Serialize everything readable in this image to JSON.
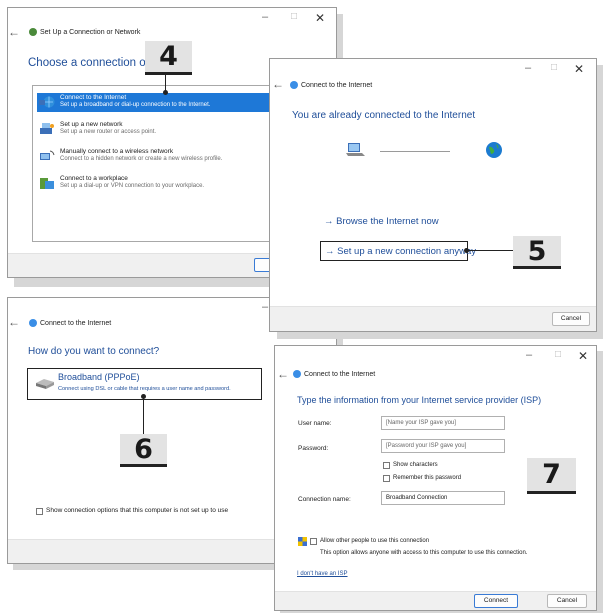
{
  "window_controls": {
    "minimize": "–",
    "maximize": "□",
    "close": "✕"
  },
  "back_arrow": "←",
  "w1": {
    "title": "Set Up a Connection or Network",
    "heading": "Choose a connection option",
    "options": [
      {
        "title": "Connect to the Internet",
        "desc": "Set up a broadband or dial-up connection to the Internet.",
        "icon": "internet-globe-icon"
      },
      {
        "title": "Set up a new network",
        "desc": "Set up a new router or access point.",
        "icon": "router-icon"
      },
      {
        "title": "Manually connect to a wireless network",
        "desc": "Connect to a hidden network or create a new wireless profile.",
        "icon": "wireless-network-icon"
      },
      {
        "title": "Connect to a workplace",
        "desc": "Set up a dial-up or VPN connection to your workplace.",
        "icon": "workplace-icon"
      }
    ],
    "next_label": "Next"
  },
  "w2": {
    "title": "Connect to the Internet",
    "heading": "You are already connected to the Internet",
    "browse_link": "→ Browse the Internet now",
    "setup_link": "→ Set up a new connection anyway",
    "cancel_label": "Cancel"
  },
  "w3": {
    "title": "Connect to the Internet",
    "heading": "How do you want to connect?",
    "option_title": "Broadband (PPPoE)",
    "option_desc": "Connect using DSL or cable that requires a user name and password.",
    "show_options_label": "Show connection options that this computer is not set up to use"
  },
  "w4": {
    "title": "Connect to the Internet",
    "heading": "Type the information from your Internet service provider (ISP)",
    "username_label": "User name:",
    "username_placeholder": "[Name your ISP gave you]",
    "password_label": "Password:",
    "password_placeholder": "[Password your ISP gave you]",
    "show_chars_label": "Show characters",
    "remember_label": "Remember this password",
    "conn_name_label": "Connection name:",
    "conn_name_value": "Broadband Connection",
    "allow_label": "Allow other people to use this connection",
    "allow_desc": "This option allows anyone with access to this computer to use this connection.",
    "no_isp_link": "I don't have an ISP",
    "connect_label": "Connect",
    "cancel_label": "Cancel"
  },
  "steps": {
    "s4": "4",
    "s5": "5",
    "s6": "6",
    "s7": "7"
  },
  "colors": {
    "accent": "#1f4e99",
    "selection": "#1e78d7",
    "badge_bg": "#e3e3e3"
  }
}
